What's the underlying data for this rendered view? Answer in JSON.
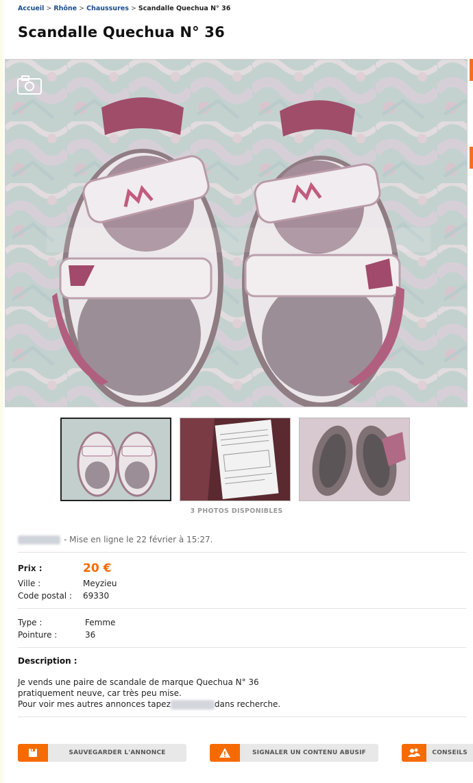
{
  "breadcrumb": {
    "items": [
      "Accueil",
      "Rhône",
      "Chaussures"
    ],
    "current": "Scandalle Quechua N° 36"
  },
  "listing": {
    "title": "Scandalle Quechua N° 36",
    "photos_available": "3 PHOTOS DISPONIBLES",
    "posted": "- Mise en ligne le 22 février à 15:27.",
    "price_label": "Prix :",
    "price": "20 €",
    "city_label": "Ville :",
    "city": "Meyzieu",
    "postal_label": "Code postal :",
    "postal": "69330",
    "type_label": "Type :",
    "type": "Femme",
    "size_label": "Pointure :",
    "size": "36",
    "description_label": "Description :",
    "description_line1": "Je vends une paire de scandale de marque Quechua N° 36",
    "description_line2": "pratiquement neuve, car très peu mise.",
    "description_line3a": "Pour voir mes autres annonces tapez",
    "description_line3b": "dans recherche."
  },
  "actions": {
    "save": "SAUVEGARDER L'ANNONCE",
    "report": "SIGNALER UN CONTENU ABUSIF",
    "advice": "CONSEILS"
  },
  "colors": {
    "accent": "#f56b00",
    "link": "#1a4d8f"
  },
  "icons": [
    "camera-icon",
    "save-icon",
    "warning-icon",
    "people-icon"
  ]
}
